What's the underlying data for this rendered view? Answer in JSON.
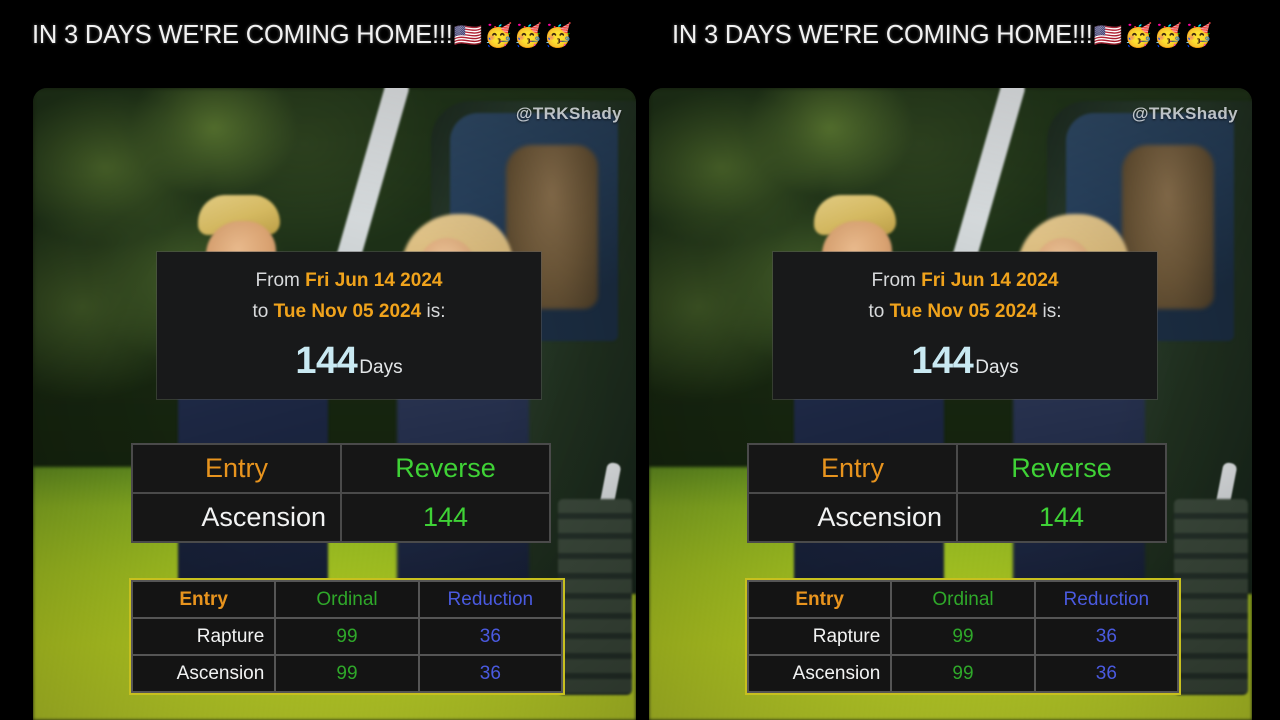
{
  "header": {
    "text": "IN 3 DAYS WE'RE COMING HOME!!!",
    "emojis": "🇺🇸",
    "party_emojis": "🥳🥳🥳",
    "repeat_count": 2
  },
  "watermark": "@TRKShady",
  "date_panel": {
    "from_label": "From",
    "from_date": "Fri Jun 14 2024",
    "to_label": "to",
    "to_date": "Tue Nov 05 2024",
    "is_label": "is:",
    "result_number": "144",
    "result_unit": "Days"
  },
  "reverse_table": {
    "headers": [
      "Entry",
      "Reverse"
    ],
    "rows": [
      {
        "entry": "Ascension",
        "reverse": "144"
      }
    ]
  },
  "gematria_table": {
    "headers": [
      "Entry",
      "Ordinal",
      "Reduction"
    ],
    "rows": [
      {
        "entry": "Rapture",
        "ordinal": "99",
        "reduction": "36"
      },
      {
        "entry": "Ascension",
        "ordinal": "99",
        "reduction": "36"
      }
    ]
  },
  "colors": {
    "background": "#000000",
    "entry_orange": "#e8941e",
    "date_gold": "#f0a31c",
    "reverse_green": "#3fd236",
    "ordinal_green": "#2fa82a",
    "reduction_blue": "#4a5ae0",
    "days_cyan": "#c9e9f2",
    "text_white": "#f2f3f3",
    "gem_border_yellow": "#c8c01e"
  },
  "scene": {
    "description": "outdoor-white-house-lawn-marine-one",
    "figures": [
      "man-in-navy-suit",
      "woman-with-sunglasses"
    ],
    "vehicle": "helicopter"
  }
}
